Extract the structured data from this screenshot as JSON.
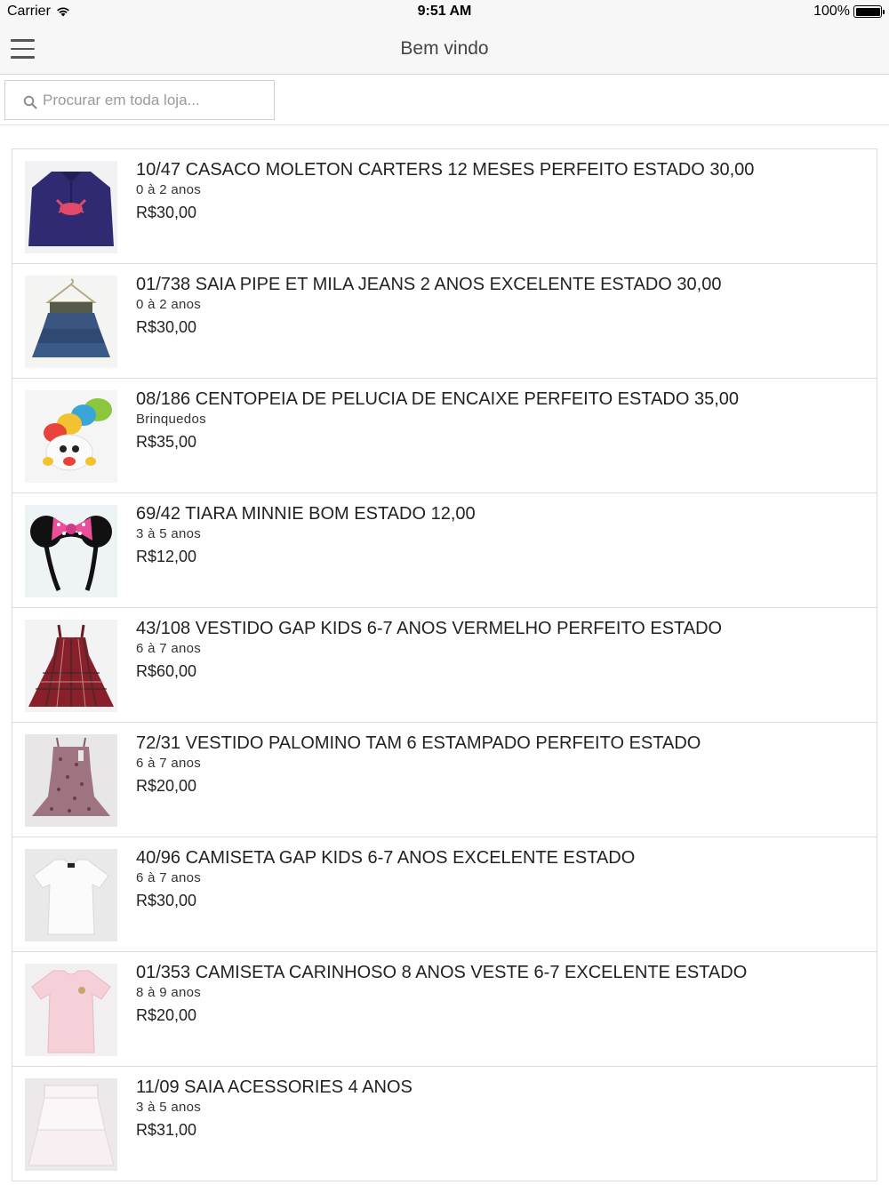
{
  "status_bar": {
    "carrier": "Carrier",
    "time": "9:51 AM",
    "battery": "100%"
  },
  "nav": {
    "title": "Bem vindo"
  },
  "search": {
    "placeholder": "Procurar em toda loja..."
  },
  "products": [
    {
      "title": "10/47 CASACO MOLETON CARTERS 12 MESES PERFEITO ESTADO 30,00",
      "category": "0 à 2 anos",
      "price": "R$30,00"
    },
    {
      "title": "01/738 SAIA PIPE ET MILA JEANS 2 ANOS EXCELENTE ESTADO 30,00",
      "category": "0 à 2 anos",
      "price": "R$30,00"
    },
    {
      "title": "08/186 CENTOPEIA DE PELUCIA DE ENCAIXE PERFEITO ESTADO 35,00",
      "category": "Brinquedos",
      "price": "R$35,00"
    },
    {
      "title": "69/42 TIARA MINNIE BOM ESTADO 12,00",
      "category": "3 à 5 anos",
      "price": "R$12,00"
    },
    {
      "title": "43/108 VESTIDO GAP KIDS 6-7 ANOS VERMELHO PERFEITO ESTADO",
      "category": "6 à 7 anos",
      "price": "R$60,00"
    },
    {
      "title": "72/31 VESTIDO PALOMINO TAM 6 ESTAMPADO PERFEITO ESTADO",
      "category": "6 à 7 anos",
      "price": "R$20,00"
    },
    {
      "title": "40/96 CAMISETA GAP KIDS 6-7 ANOS EXCELENTE ESTADO",
      "category": "6 à 7 anos",
      "price": "R$30,00"
    },
    {
      "title": "01/353 CAMISETA CARINHOSO 8 ANOS VESTE 6-7 EXCELENTE ESTADO",
      "category": "8 à 9 anos",
      "price": "R$20,00"
    },
    {
      "title": "11/09 SAIA ACESSORIES 4 ANOS",
      "category": "3 à 5 anos",
      "price": "R$31,00"
    }
  ]
}
